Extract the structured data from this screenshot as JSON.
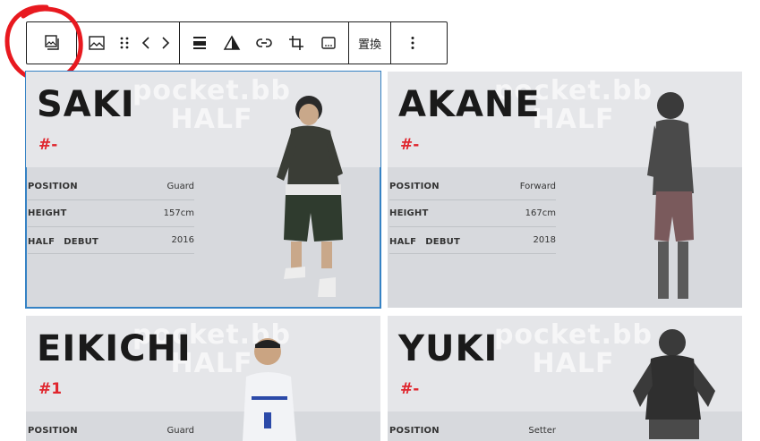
{
  "toolbar": {
    "replace_label": "置換"
  },
  "cards": [
    {
      "name": "SAKI",
      "number": "#-",
      "watermark_line1": "pocket.bb",
      "watermark_line2": "HALF",
      "stats": [
        {
          "label": "POSITION",
          "value": "Guard"
        },
        {
          "label": "HEIGHT",
          "value": "157cm"
        },
        {
          "label": "HALF　DEBUT",
          "value": "2016"
        }
      ]
    },
    {
      "name": "AKANE",
      "number": "#-",
      "watermark_line1": "pocket.bb",
      "watermark_line2": "HALF",
      "stats": [
        {
          "label": "POSITION",
          "value": "Forward"
        },
        {
          "label": "HEIGHT",
          "value": "167cm"
        },
        {
          "label": "HALF　DEBUT",
          "value": "2018"
        }
      ]
    },
    {
      "name": "EIKICHI",
      "number": "#1",
      "watermark_line1": "pocket.bb",
      "watermark_line2": "HALF",
      "stats": [
        {
          "label": "POSITION",
          "value": "Guard"
        }
      ]
    },
    {
      "name": "YUKI",
      "number": "#-",
      "watermark_line1": "pocket.bb",
      "watermark_line2": "HALF",
      "stats": [
        {
          "label": "POSITION",
          "value": "Setter"
        }
      ]
    }
  ],
  "colors": {
    "accent_red": "#e0262e",
    "selection_blue": "#3582c4"
  }
}
